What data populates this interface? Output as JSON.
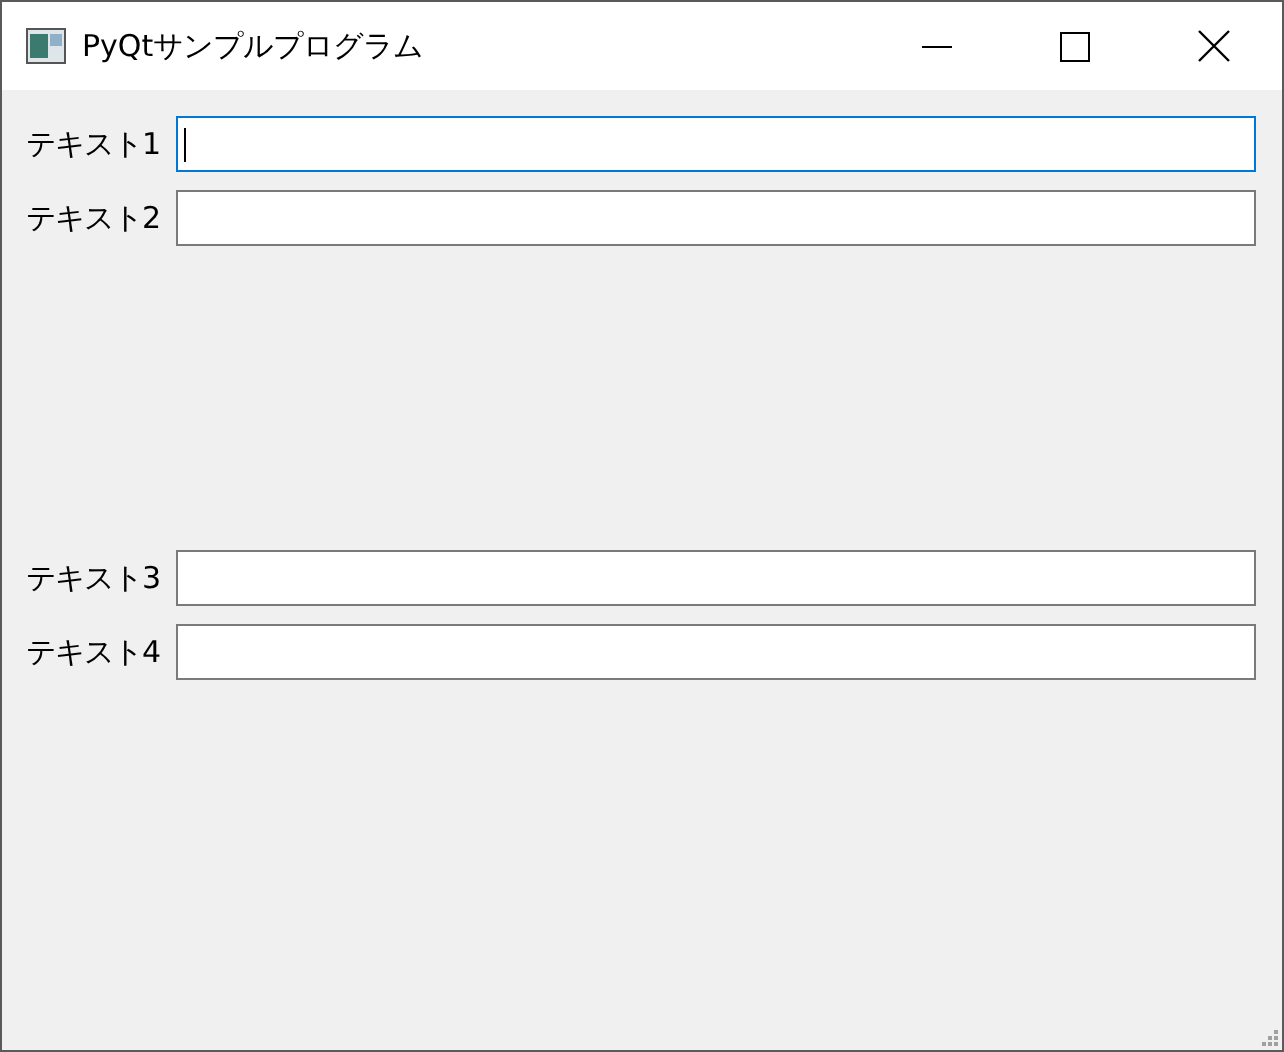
{
  "window": {
    "title": "PyQtサンプルプログラム"
  },
  "groups": [
    {
      "fields": [
        {
          "label": "テキスト1",
          "focused": true
        },
        {
          "label": "テキスト2",
          "focused": false
        }
      ]
    },
    {
      "fields": [
        {
          "label": "テキスト3",
          "focused": false
        },
        {
          "label": "テキスト4",
          "focused": false
        }
      ]
    }
  ]
}
